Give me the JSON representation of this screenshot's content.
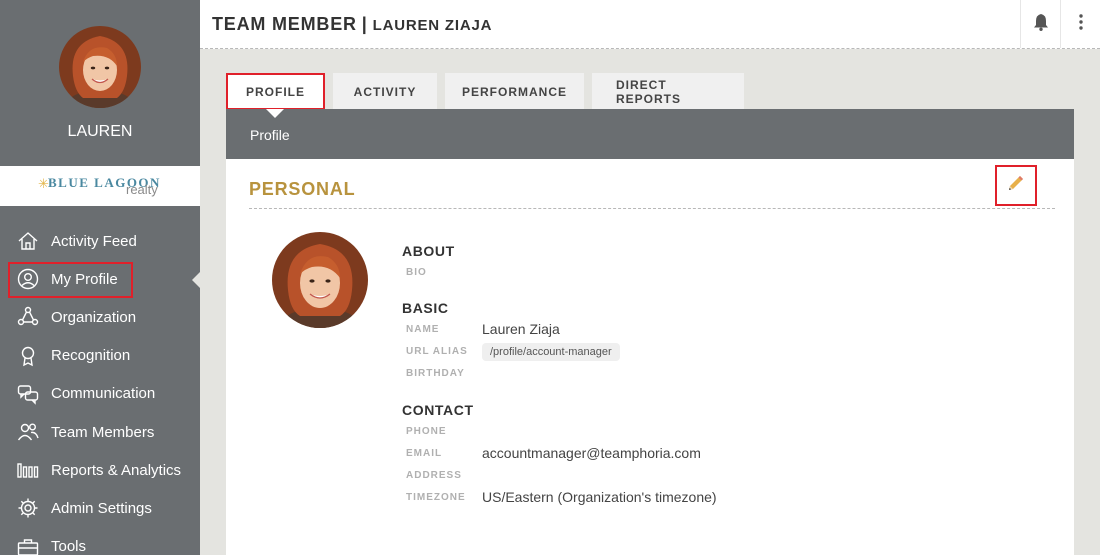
{
  "header": {
    "title": "TEAM MEMBER",
    "separator": "|",
    "subtitle": "LAUREN ZIAJA",
    "icons": [
      "bell-icon",
      "more-vertical-icon"
    ]
  },
  "sidebar": {
    "user_name": "LAUREN",
    "brand": {
      "name": "BLUE LAGOON",
      "sub": "realty"
    },
    "items": [
      {
        "label": "Activity Feed",
        "icon": "home-icon"
      },
      {
        "label": "My Profile",
        "icon": "user-circle-icon",
        "active": true
      },
      {
        "label": "Organization",
        "icon": "org-network-icon"
      },
      {
        "label": "Recognition",
        "icon": "award-ribbon-icon"
      },
      {
        "label": "Communication",
        "icon": "chat-bubbles-icon"
      },
      {
        "label": "Team Members",
        "icon": "people-icon"
      },
      {
        "label": "Reports & Analytics",
        "icon": "bars-icon"
      },
      {
        "label": "Admin Settings",
        "icon": "gear-icon"
      },
      {
        "label": "Tools",
        "icon": "toolbox-icon"
      }
    ]
  },
  "tabs": [
    {
      "label": "PROFILE",
      "active": true
    },
    {
      "label": "ACTIVITY"
    },
    {
      "label": "PERFORMANCE"
    },
    {
      "label": "DIRECT REPORTS"
    }
  ],
  "panel": {
    "subbar_label": "Profile",
    "section_title": "PERSONAL",
    "about": {
      "title": "ABOUT",
      "bio_label": "BIO"
    },
    "basic": {
      "title": "BASIC",
      "name_label": "NAME",
      "name_value": "Lauren Ziaja",
      "url_label": "URL ALIAS",
      "url_value": "/profile/account-manager",
      "birthday_label": "BIRTHDAY"
    },
    "contact": {
      "title": "CONTACT",
      "phone_label": "PHONE",
      "email_label": "EMAIL",
      "email_value": "accountmanager@teamphoria.com",
      "address_label": "ADDRESS",
      "timezone_label": "TIMEZONE",
      "timezone_value": "US/Eastern (Organization's timezone)"
    }
  },
  "colors": {
    "sidebar_bg": "#6a6e71",
    "accent_gold": "#b8933e",
    "highlight_red": "#e0202a",
    "page_bg": "#e4e4e0"
  }
}
